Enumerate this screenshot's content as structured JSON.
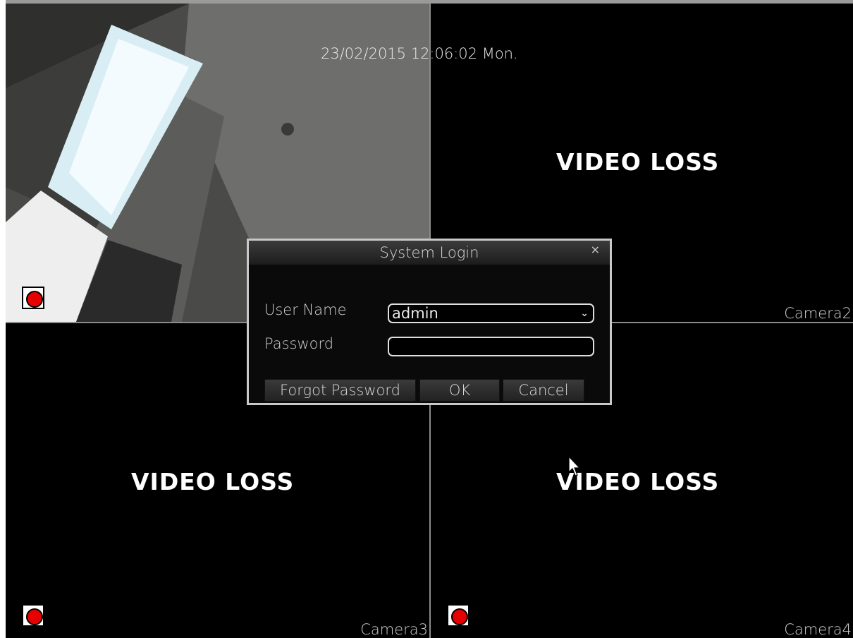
{
  "overlay": {
    "datetime": "23/02/2015  12:06:02 Mon."
  },
  "tiles": [
    {
      "id": "camera1",
      "status": "",
      "label": "",
      "recording": true
    },
    {
      "id": "camera2",
      "status": "VIDEO LOSS",
      "label": "Camera2",
      "recording": false
    },
    {
      "id": "camera3",
      "status": "VIDEO LOSS",
      "label": "Camera3",
      "recording": true
    },
    {
      "id": "camera4",
      "status": "VIDEO LOSS",
      "label": "Camera4",
      "recording": true
    }
  ],
  "dialog": {
    "title": "System Login",
    "close_glyph": "×",
    "username_label": "User Name",
    "username_value": "admin",
    "password_label": "Password",
    "password_value": "",
    "buttons": {
      "forgot": "Forgot Password",
      "ok": "OK",
      "cancel": "Cancel"
    }
  },
  "colors": {
    "record": "#e60000",
    "dialog_border": "#c9c9c9"
  }
}
